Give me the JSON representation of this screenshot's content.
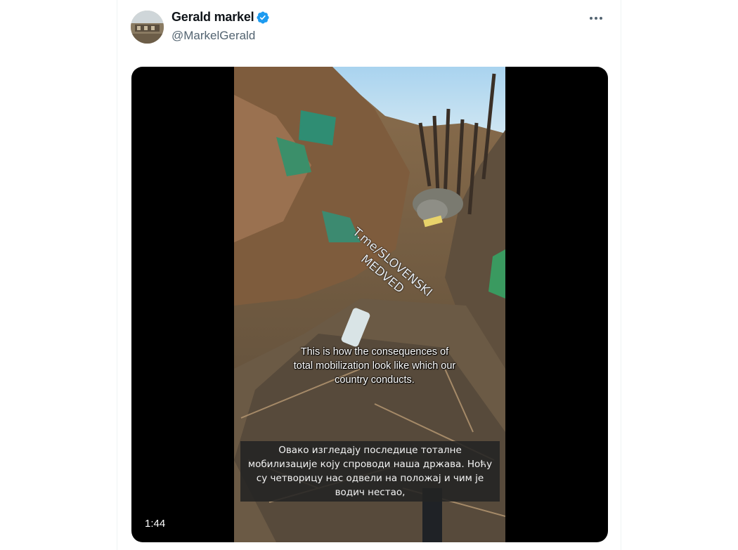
{
  "author": {
    "display_name": "Gerald markel",
    "handle": "@MarkelGerald",
    "verified": true,
    "avatar_icon": "avatar-photo"
  },
  "menu": {
    "icon": "more-dots-icon"
  },
  "video": {
    "duration": "1:44",
    "watermark": "T.me/SLOVENSKI MEDVED",
    "subtitle_english": "This is how the consequences of total mobilization look like which our country conducts.",
    "subtitle_serbian": "Овако изгледају последице тоталне мобилизације коју спроводи наша држава. Ноћу су четворицу нас одвели на положај и чим је водич нестао,"
  },
  "colors": {
    "verified": "#1d9bf0",
    "name": "#0f1419",
    "handle": "#536471",
    "video_bg": "#000000"
  }
}
